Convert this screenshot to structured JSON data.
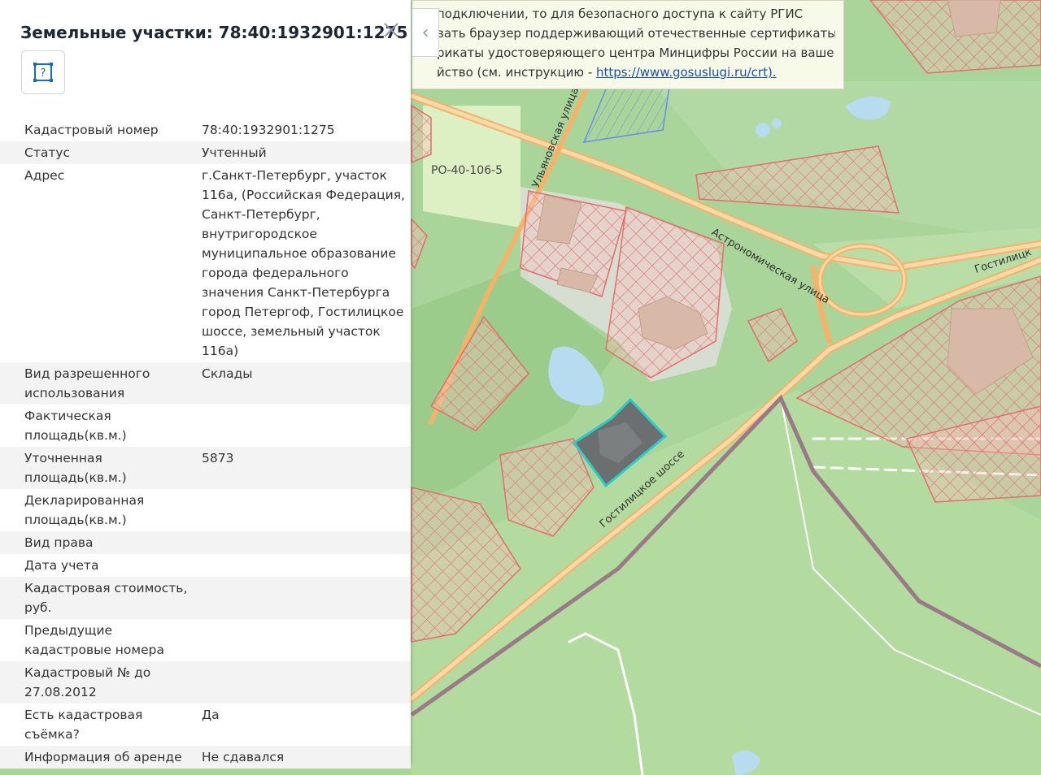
{
  "panel": {
    "title": "Земельные участки: 78:40:1932901:1275",
    "close_icon": "close-icon",
    "tool_icon": "select-area-icon",
    "tool_glyph": "?",
    "rows": [
      {
        "key": "Кадастровый номер",
        "value": "78:40:1932901:1275"
      },
      {
        "key": "Статус",
        "value": "Учтенный"
      },
      {
        "key": "Адрес",
        "value": "г.Санкт-Петербург, участок 116а, (Российская Федерация, Санкт-Петербург, внутригородское муниципальное образование города федерального значения Санкт-Петербурга город Петергоф, Гостилицкое шоссе, земельный участок 116а)"
      },
      {
        "key": "Вид разрешенного использования",
        "value": "Склады"
      },
      {
        "key": "Фактическая площадь(кв.м.)",
        "value": ""
      },
      {
        "key": "Уточненная площадь(кв.м.)",
        "value": "5873"
      },
      {
        "key": "Декларированная площадь(кв.м.)",
        "value": ""
      },
      {
        "key": "Вид права",
        "value": ""
      },
      {
        "key": "Дата учета",
        "value": ""
      },
      {
        "key": "Кадастровая стоимость, руб.",
        "value": ""
      },
      {
        "key": "Предыдущие кадастровые номера",
        "value": ""
      },
      {
        "key": "Кадастровый № до 27.08.2012",
        "value": ""
      },
      {
        "key": "Есть кадастровая съёмка?",
        "value": "Да"
      },
      {
        "key": "Информация об аренде",
        "value": "Не сдавался"
      }
    ]
  },
  "notice": {
    "line1": "подключении, то для безопасного доступа к сайту РГИС",
    "line2": "вать браузер поддерживающий отечественные сертификаты",
    "line3": "рикаты удостоверяющего центра Минцифры России на ваше",
    "line4_prefix": "йство (см. инструкцию - ",
    "link": "https://www.gosuslugi.ru/crt).",
    "collapse_icon": "chevron-left-icon",
    "collapse_glyph": "‹"
  },
  "map": {
    "labels": {
      "zone": "РО-40-106-5",
      "street_ulyanovskaya": "Ульяновская улица",
      "street_astronomicheskaya": "Астрономическая улица",
      "street_gostilitskoe": "Гостилицкое шоссе",
      "street_gostilitskoe_short": "Гостилицк"
    },
    "colors": {
      "forest": "#a9d49a",
      "road": "#f4b36a",
      "parcel": "#e46d6d",
      "selected_parcel": "#2ec9c9",
      "water": "#b7dcef",
      "boundary": "#9a7a86"
    }
  }
}
